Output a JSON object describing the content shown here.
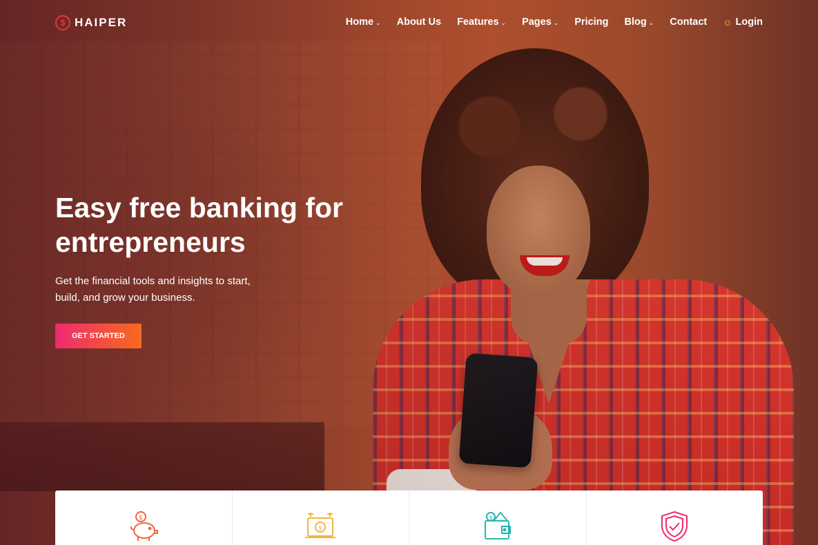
{
  "brand": {
    "name": "HAIPER",
    "logo_color": "#e8353b"
  },
  "nav": {
    "items": [
      {
        "label": "Home",
        "has_dropdown": true
      },
      {
        "label": "About Us",
        "has_dropdown": false
      },
      {
        "label": "Features",
        "has_dropdown": true
      },
      {
        "label": "Pages",
        "has_dropdown": true
      },
      {
        "label": "Pricing",
        "has_dropdown": false
      },
      {
        "label": "Blog",
        "has_dropdown": true
      },
      {
        "label": "Contact",
        "has_dropdown": false
      }
    ],
    "login_label": "Login",
    "login_icon": "user-icon",
    "dropdown_icon": "chevron-down-icon"
  },
  "hero": {
    "headline_line1": "Easy free banking for",
    "headline_line2": "entrepreneurs",
    "subtitle_line1": "Get the financial tools and insights to start,",
    "subtitle_line2": "build, and grow your business.",
    "cta_label": "GET STARTED"
  },
  "features": [
    {
      "icon": "piggy-bank-icon",
      "color": "#f0623f"
    },
    {
      "icon": "online-payment-icon",
      "color": "#f2b33d"
    },
    {
      "icon": "wallet-icon",
      "color": "#26b6b0"
    },
    {
      "icon": "shield-check-icon",
      "color": "#ee2a6f"
    }
  ],
  "colors": {
    "accent_gradient_start": "#ee2a6f",
    "accent_gradient_end": "#f76b1c",
    "login_icon": "#f6c04a"
  }
}
